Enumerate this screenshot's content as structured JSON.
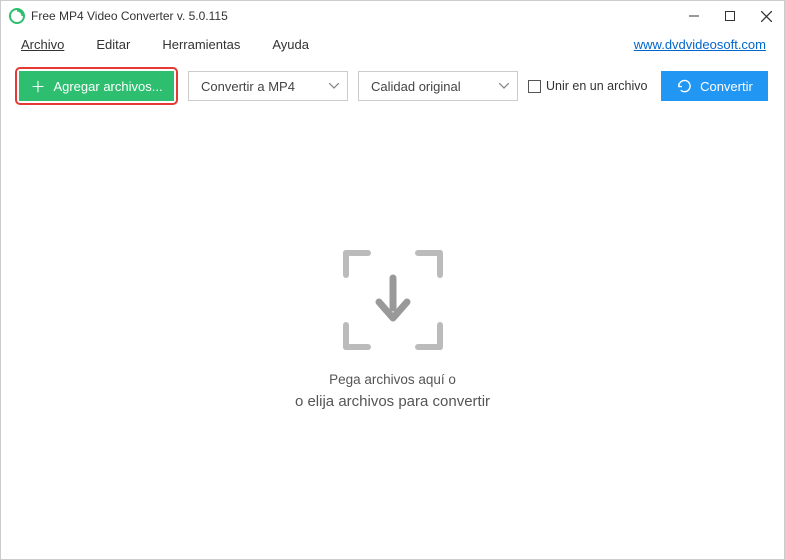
{
  "titlebar": {
    "title": "Free MP4 Video Converter v. 5.0.115"
  },
  "menubar": {
    "file": "Archivo",
    "edit": "Editar",
    "tools": "Herramientas",
    "help": "Ayuda",
    "link": "www.dvdvideosoft.com"
  },
  "toolbar": {
    "add_label": "Agregar archivos...",
    "format_selected": "Convertir a MP4",
    "quality_selected": "Calidad original",
    "join_label": "Unir en un archivo",
    "convert_label": "Convertir"
  },
  "dropzone": {
    "line1": "Pega archivos aquí o",
    "line2": "o elija archivos para convertir"
  }
}
